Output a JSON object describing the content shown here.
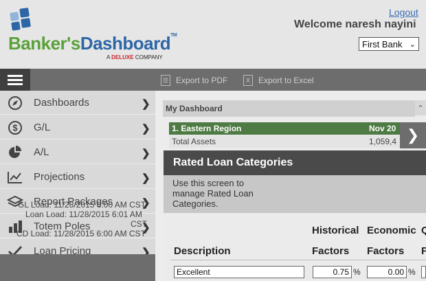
{
  "header": {
    "logo_part1": "Banker's",
    "logo_part2": "Dashboard",
    "logo_tm": "TM",
    "logo_sub_prefix": "A",
    "logo_sub_brand": "DELUXE",
    "logo_sub_suffix": "COMPANY",
    "logout": "Logout",
    "welcome": "Welcome  naresh nayini",
    "bank_selected": "First Bank"
  },
  "toolbar": {
    "export_pdf": "Export to PDF",
    "export_excel": "Export to Excel"
  },
  "sidebar": {
    "items": [
      {
        "label": "Dashboards",
        "icon": "compass-icon"
      },
      {
        "label": "G/L",
        "icon": "dollar-icon"
      },
      {
        "label": "A/L",
        "icon": "pie-chart-icon"
      },
      {
        "label": "Projections",
        "icon": "line-chart-icon"
      },
      {
        "label": "Report Packages",
        "icon": "layers-icon"
      },
      {
        "label": "Totem Poles",
        "icon": "bar-chart-icon"
      },
      {
        "label": "Loan Pricing",
        "icon": "check-icon"
      }
    ],
    "load_info": {
      "gl_load": "GL Load: 11/28/2015 6:00 AM CST",
      "loan_load": "Loan Load: 11/28/2015 6:01 AM",
      "loan_load_tz": "CST",
      "cd_load": "CD Load: 11/28/2015 6:00 AM CST"
    }
  },
  "dashboard": {
    "title": "My Dashboard",
    "region": "1. Eastern Region",
    "region_date": "Nov 20",
    "metric_label": "Total Assets",
    "metric_value": "1,059,4"
  },
  "rated_loans": {
    "title": "Rated Loan Categories",
    "description": "Use this screen to manage Rated Loan Categories.",
    "columns": {
      "description": "Description",
      "historical_1": "Historical",
      "historical_2": "Factors",
      "economic_1": "Economic",
      "economic_2": "Factors",
      "q_1": "Q",
      "q_2": "F"
    },
    "rows": [
      {
        "description": "Excellent",
        "historical": "0.75",
        "economic": "0.00",
        "pct": "%"
      }
    ]
  }
}
